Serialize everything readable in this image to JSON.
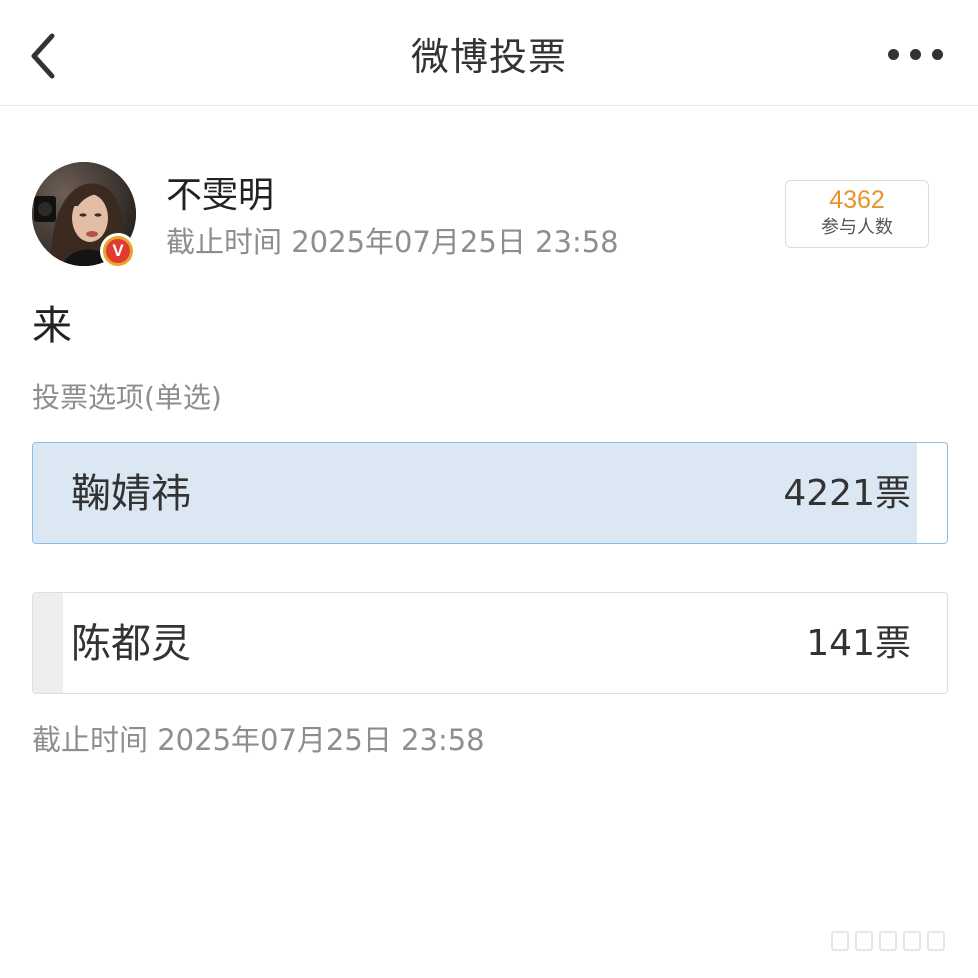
{
  "nav": {
    "title": "微博投票",
    "back_icon": "chevron-left-icon",
    "more_icon": "more-horizontal-icon"
  },
  "poll": {
    "author": {
      "name": "不雯明",
      "verified": true,
      "badge_letter": "V"
    },
    "deadline_top": "截止时间 2025年07月25日 23:58",
    "participants": {
      "count": "4362",
      "label": "参与人数"
    },
    "question": "来",
    "options_hint": "投票选项(单选)",
    "options": [
      {
        "label": "鞠婧祎",
        "votes_text": "4221票",
        "votes": 4221,
        "selected": true
      },
      {
        "label": "陈都灵",
        "votes_text": "141票",
        "votes": 141,
        "selected": false
      }
    ],
    "deadline_bottom": "截止时间 2025年07月25日 23:58"
  },
  "colors": {
    "accent_orange": "#e8922a",
    "selected_border": "#8dbfe6",
    "selected_fill": "#dbe7f3",
    "unselected_fill": "#eeeeee",
    "verified_red": "#e03b2e",
    "verified_gold": "#e8a42c"
  }
}
